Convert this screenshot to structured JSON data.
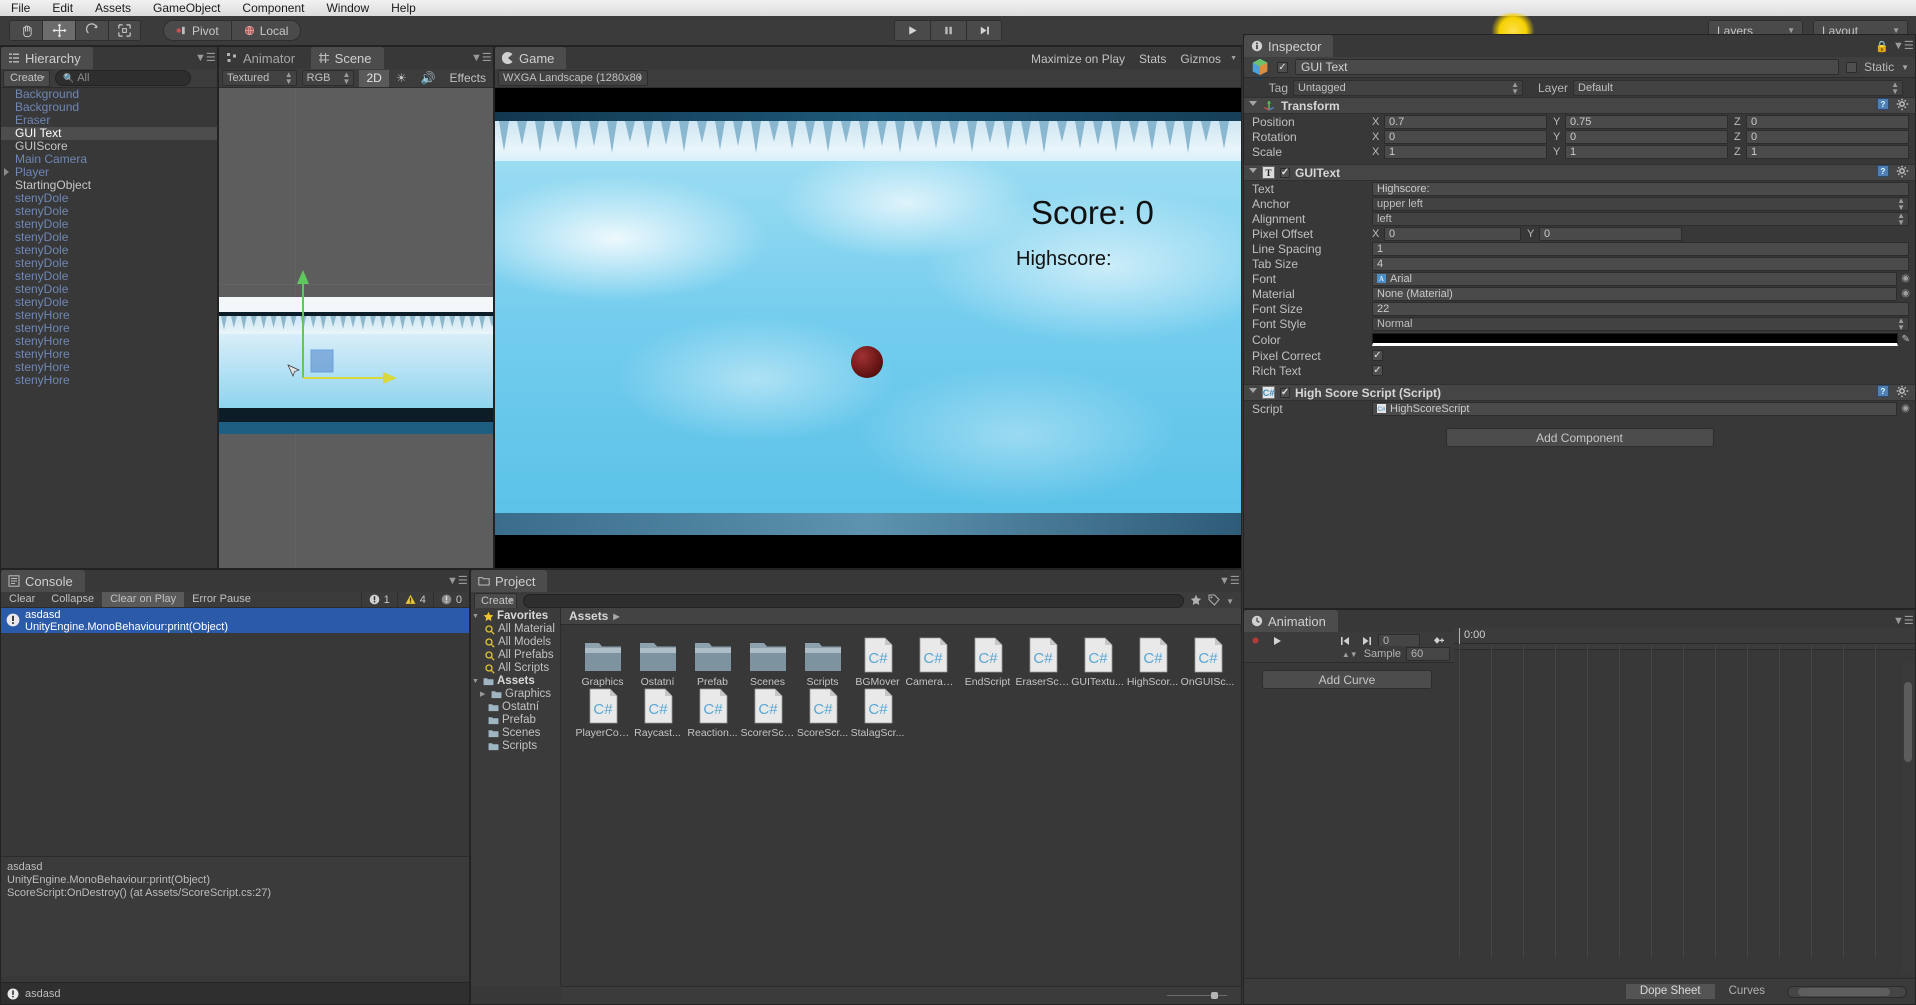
{
  "menubar": {
    "items": [
      "File",
      "Edit",
      "Assets",
      "GameObject",
      "Component",
      "Window",
      "Help"
    ]
  },
  "toolbar": {
    "tools": [
      "hand-tool",
      "move-tool",
      "rotate-tool",
      "scale-tool"
    ],
    "pivot_label": "Pivot",
    "local_label": "Local",
    "play_label": "▶",
    "pause_label": "▐▐",
    "step_label": "▶|",
    "layers_label": "Layers",
    "layout_label": "Layout"
  },
  "hierarchy": {
    "tab": "Hierarchy",
    "create_label": "Create",
    "search_placeholder": "All",
    "items": [
      {
        "label": "Background",
        "style": "prefab",
        "expandable": false
      },
      {
        "label": "Background",
        "style": "prefab",
        "expandable": false
      },
      {
        "label": "Eraser",
        "style": "prefab",
        "expandable": false
      },
      {
        "label": "GUI Text",
        "style": "normal",
        "expandable": false,
        "selected": true
      },
      {
        "label": "GUIScore",
        "style": "normal",
        "expandable": false
      },
      {
        "label": "Main Camera",
        "style": "prefab",
        "expandable": false
      },
      {
        "label": "Player",
        "style": "prefab",
        "expandable": true
      },
      {
        "label": "StartingObject",
        "style": "normal",
        "expandable": false
      },
      {
        "label": "stenyDole",
        "style": "prefab",
        "expandable": false
      },
      {
        "label": "stenyDole",
        "style": "prefab",
        "expandable": false
      },
      {
        "label": "stenyDole",
        "style": "prefab",
        "expandable": false
      },
      {
        "label": "stenyDole",
        "style": "prefab",
        "expandable": false
      },
      {
        "label": "stenyDole",
        "style": "prefab",
        "expandable": false
      },
      {
        "label": "stenyDole",
        "style": "prefab",
        "expandable": false
      },
      {
        "label": "stenyDole",
        "style": "prefab",
        "expandable": false
      },
      {
        "label": "stenyDole",
        "style": "prefab",
        "expandable": false
      },
      {
        "label": "stenyDole",
        "style": "prefab",
        "expandable": false
      },
      {
        "label": "stenyHore",
        "style": "prefab",
        "expandable": false
      },
      {
        "label": "stenyHore",
        "style": "prefab",
        "expandable": false
      },
      {
        "label": "stenyHore",
        "style": "prefab",
        "expandable": false
      },
      {
        "label": "stenyHore",
        "style": "prefab",
        "expandable": false
      },
      {
        "label": "stenyHore",
        "style": "prefab",
        "expandable": false
      },
      {
        "label": "stenyHore",
        "style": "prefab",
        "expandable": false
      }
    ]
  },
  "scene": {
    "animator_tab": "Animator",
    "scene_tab": "Scene",
    "draw_mode": "Textured",
    "color_mode": "RGB",
    "two_d_label": "2D",
    "effects_label": "Effects"
  },
  "game": {
    "tab": "Game",
    "aspect": "WXGA Landscape (1280x80",
    "maximize_label": "Maximize on Play",
    "stats_label": "Stats",
    "gizmos_label": "Gizmos",
    "score_text": "Score: 0",
    "highscore_text": "Highscore:"
  },
  "inspector": {
    "tab": "Inspector",
    "object_name": "GUI Text",
    "static_label": "Static",
    "tag_label": "Tag",
    "tag_value": "Untagged",
    "layer_label": "Layer",
    "layer_value": "Default",
    "transform": {
      "title": "Transform",
      "rows": [
        {
          "label": "Position",
          "x": "0.7",
          "y": "0.75",
          "z": "0"
        },
        {
          "label": "Rotation",
          "x": "0",
          "y": "0",
          "z": "0"
        },
        {
          "label": "Scale",
          "x": "1",
          "y": "1",
          "z": "1"
        }
      ]
    },
    "guitext": {
      "title": "GUIText",
      "text_label": "Text",
      "text_value": "Highscore:",
      "anchor_label": "Anchor",
      "anchor_value": "upper left",
      "alignment_label": "Alignment",
      "alignment_value": "left",
      "pixel_offset_label": "Pixel Offset",
      "pixel_offset_x": "0",
      "pixel_offset_y": "0",
      "line_spacing_label": "Line Spacing",
      "line_spacing_value": "1",
      "tab_size_label": "Tab Size",
      "tab_size_value": "4",
      "font_label": "Font",
      "font_value": "Arial",
      "material_label": "Material",
      "material_value": "None (Material)",
      "font_size_label": "Font Size",
      "font_size_value": "22",
      "font_style_label": "Font Style",
      "font_style_value": "Normal",
      "color_label": "Color",
      "color_value": "#000000",
      "pixel_correct_label": "Pixel Correct",
      "rich_text_label": "Rich Text"
    },
    "script_component": {
      "title": "High Score Script (Script)",
      "script_label": "Script",
      "script_value": "HighScoreScript"
    },
    "add_component_label": "Add Component"
  },
  "console": {
    "tab": "Console",
    "buttons": [
      "Clear",
      "Collapse",
      "Clear on Play",
      "Error Pause"
    ],
    "counts": {
      "info": "1",
      "warning": "4",
      "error": "0"
    },
    "log_title": "asdasd",
    "log_sub": "UnityEngine.MonoBehaviour:print(Object)",
    "stack": "asdasd\nUnityEngine.MonoBehaviour:print(Object)\nScoreScript:OnDestroy() (at Assets/ScoreScript.cs:27)",
    "status_text": "asdasd"
  },
  "project": {
    "tab": "Project",
    "create_label": "Create",
    "breadcrumb": "Assets",
    "favorites_label": "Favorites",
    "favorites": [
      "All Material",
      "All Models",
      "All Prefabs",
      "All Scripts"
    ],
    "assets_root_label": "Assets",
    "folders": [
      "Graphics",
      "Ostatní",
      "Prefab",
      "Scenes",
      "Scripts"
    ],
    "grid": [
      {
        "name": "Graphics",
        "type": "folder"
      },
      {
        "name": "Ostatní",
        "type": "folder"
      },
      {
        "name": "Prefab",
        "type": "folder"
      },
      {
        "name": "Scenes",
        "type": "folder"
      },
      {
        "name": "Scripts",
        "type": "folder"
      },
      {
        "name": "BGMover",
        "type": "csharp"
      },
      {
        "name": "CameraFo...",
        "type": "csharp"
      },
      {
        "name": "EndScript",
        "type": "csharp"
      },
      {
        "name": "EraserScr...",
        "type": "csharp"
      },
      {
        "name": "GUITextu...",
        "type": "csharp"
      },
      {
        "name": "HighScor...",
        "type": "csharp"
      },
      {
        "name": "OnGUISc...",
        "type": "csharp"
      },
      {
        "name": "PlayerCol...",
        "type": "csharp"
      },
      {
        "name": "Raycast...",
        "type": "csharp"
      },
      {
        "name": "Reaction...",
        "type": "csharp"
      },
      {
        "name": "ScorerScr...",
        "type": "csharp"
      },
      {
        "name": "ScoreScr...",
        "type": "csharp"
      },
      {
        "name": "StalagScr...",
        "type": "csharp"
      }
    ]
  },
  "animation": {
    "tab": "Animation",
    "frame_value": "0",
    "sample_label": "Sample",
    "sample_value": "60",
    "time_label": "0:00",
    "add_curve_label": "Add Curve",
    "dope_sheet_label": "Dope Sheet",
    "curves_label": "Curves"
  },
  "colors": {
    "panel_bg": "#383838",
    "selection_blue": "#2b5ba8",
    "hierarchy_prefab": "#6f87b5",
    "accent_yellow": "#f5d000"
  }
}
